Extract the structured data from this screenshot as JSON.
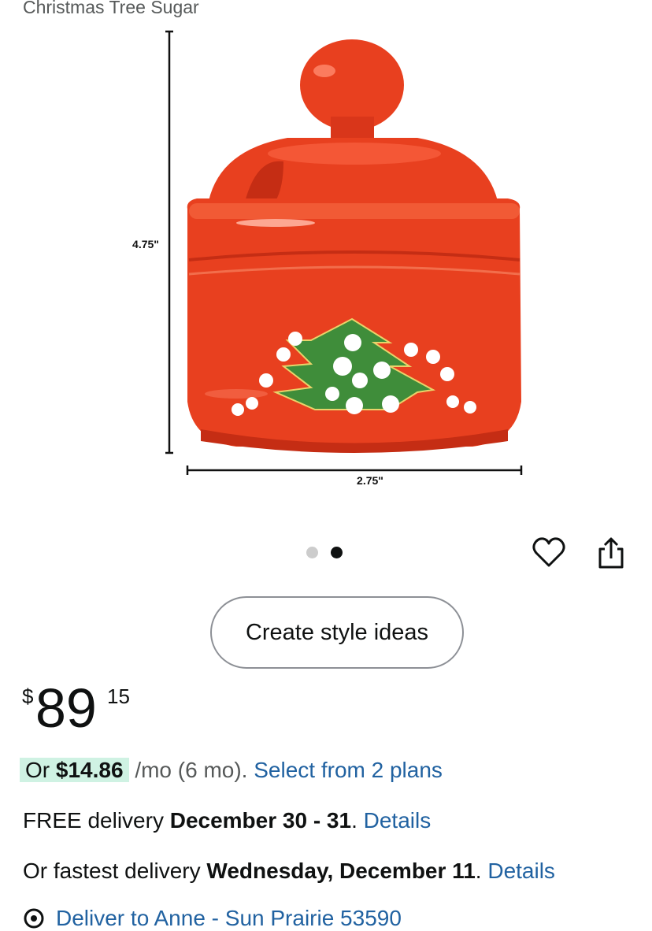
{
  "product": {
    "title": "Christmas Tree Sugar",
    "dim_height": "4.75\"",
    "dim_width": "2.75\""
  },
  "carousel": {
    "total": 2,
    "active": 2
  },
  "style_button": {
    "label": "Create style ideas"
  },
  "price": {
    "symbol": "$",
    "whole": "89",
    "fraction": "15"
  },
  "installment": {
    "or": "Or",
    "amount": "$14.86",
    "term": "/mo (6 mo).",
    "link": "Select from 2 plans"
  },
  "delivery": {
    "free_prefix": "FREE delivery",
    "free_date": "December 30 - 31",
    "free_suffix": ".",
    "details_link": "Details",
    "fast_prefix": "Or fastest delivery",
    "fast_date": "Wednesday, December 11",
    "fast_suffix": ".",
    "fast_details_link": "Details",
    "deliver_to": "Deliver to Anne - Sun Prairie 53590"
  },
  "colors": {
    "link": "#2162a1",
    "highlight": "#cff2e3",
    "jar_red": "#e8401f",
    "tree_green": "#3f8d3a",
    "dot_active": "#0f1111",
    "dot_inactive": "#cccccc"
  },
  "icons": [
    "heart-icon",
    "share-icon",
    "location-pin-icon"
  ]
}
